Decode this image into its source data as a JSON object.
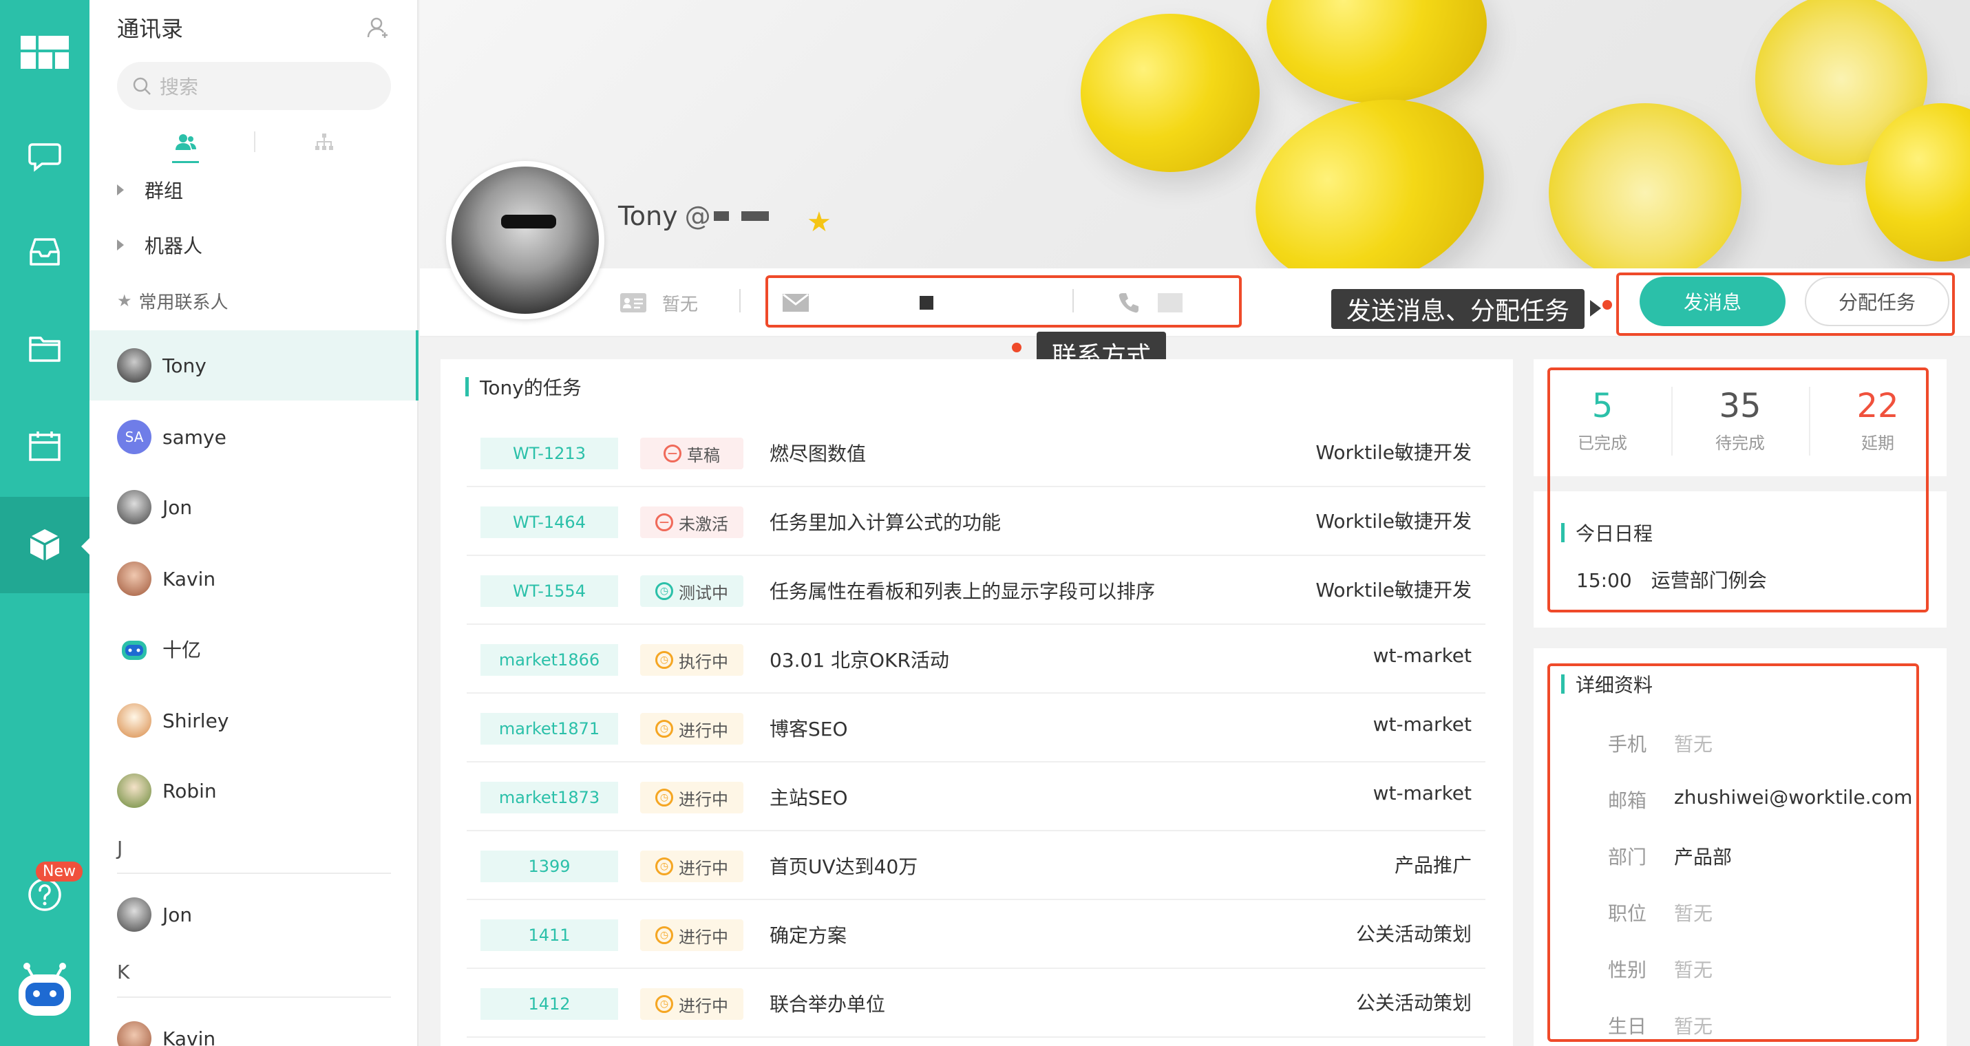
{
  "colors": {
    "accent": "#2bc0a9",
    "annotation": "#ef4a2a",
    "overdue": "#f0513c",
    "star": "#f5c515"
  },
  "rail": {
    "new_badge": "New"
  },
  "contacts": {
    "title": "通讯录",
    "search_placeholder": "搜索",
    "groups": [
      "群组",
      "机器人"
    ],
    "favorites_label": "常用联系人",
    "people": [
      {
        "name": "Tony",
        "avatar": "photo"
      },
      {
        "name": "samye",
        "avatar": "SA"
      },
      {
        "name": "Jon",
        "avatar": "photo"
      },
      {
        "name": "Kavin",
        "avatar": "photo"
      },
      {
        "name": "十亿",
        "avatar": "robot"
      },
      {
        "name": "Shirley",
        "avatar": "photo"
      },
      {
        "name": "Robin",
        "avatar": "photo"
      }
    ],
    "section_j": "J",
    "section_j_people": [
      "Jon"
    ],
    "section_k": "K",
    "section_k_people": [
      "Kavin"
    ]
  },
  "profile": {
    "name": "Tony",
    "at": "@",
    "id_value": "暂无",
    "send_message": "发消息",
    "assign_task": "分配任务"
  },
  "annotations": {
    "contact_info": "联系方式",
    "actions": "发送消息、分配任务"
  },
  "tasks": {
    "title": "Tony的任务",
    "rows": [
      {
        "id": "WT-1213",
        "status": "草稿",
        "kind": "draft",
        "title": "燃尽图数值",
        "project": "Worktile敏捷开发"
      },
      {
        "id": "WT-1464",
        "status": "未激活",
        "kind": "draft",
        "title": "任务里加入计算公式的功能",
        "project": "Worktile敏捷开发"
      },
      {
        "id": "WT-1554",
        "status": "测试中",
        "kind": "test",
        "title": "任务属性在看板和列表上的显示字段可以排序",
        "project": "Worktile敏捷开发"
      },
      {
        "id": "market1866",
        "status": "执行中",
        "kind": "doing",
        "title": "03.01 北京OKR活动",
        "project": "wt-market"
      },
      {
        "id": "market1871",
        "status": "进行中",
        "kind": "doing",
        "title": "博客SEO",
        "project": "wt-market"
      },
      {
        "id": "market1873",
        "status": "进行中",
        "kind": "doing",
        "title": "主站SEO",
        "project": "wt-market"
      },
      {
        "id": "1399",
        "status": "进行中",
        "kind": "doing",
        "title": "首页UV达到40万",
        "project": "产品推广"
      },
      {
        "id": "1411",
        "status": "进行中",
        "kind": "doing",
        "title": "确定方案",
        "project": "公关活动策划"
      },
      {
        "id": "1412",
        "status": "进行中",
        "kind": "doing",
        "title": "联合举办单位",
        "project": "公关活动策划"
      }
    ]
  },
  "stats": {
    "done": {
      "value": "5",
      "label": "已完成"
    },
    "todo": {
      "value": "35",
      "label": "待完成"
    },
    "late": {
      "value": "22",
      "label": "延期"
    }
  },
  "schedule": {
    "title": "今日日程",
    "time": "15:00",
    "event": "运营部门例会"
  },
  "details": {
    "title": "详细资料",
    "rows": [
      {
        "key": "手机",
        "value": "暂无",
        "empty": true
      },
      {
        "key": "邮箱",
        "value": "zhushiwei@worktile.com",
        "empty": false
      },
      {
        "key": "部门",
        "value": "产品部",
        "empty": false
      },
      {
        "key": "职位",
        "value": "暂无",
        "empty": true
      },
      {
        "key": "性别",
        "value": "暂无",
        "empty": true
      },
      {
        "key": "生日",
        "value": "暂无",
        "empty": true
      }
    ]
  }
}
